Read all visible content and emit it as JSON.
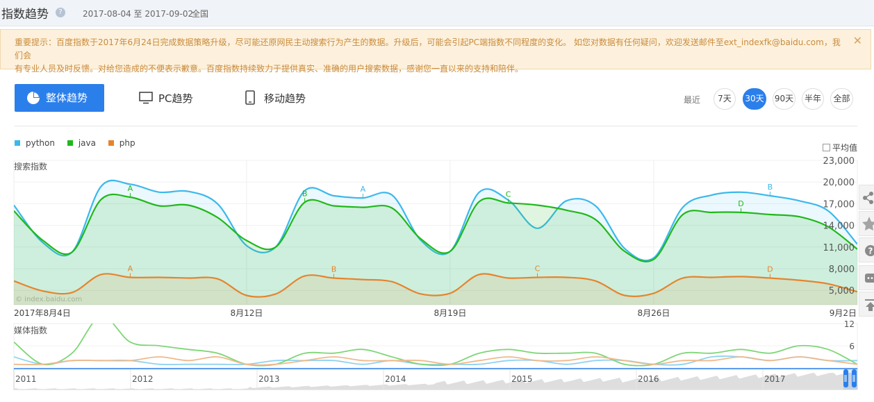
{
  "header": {
    "title": "指数趋势",
    "help_glyph": "?",
    "date_range": "2017-08-04 至 2017-09-02",
    "region": "全国"
  },
  "notice": {
    "line1": "重要提示：百度指数于2017年6月24日完成数据策略升级，尽可能还原网民主动搜索行为产生的数据。升级后，可能会引起PC端指数不同程度的变化。 如您对数据有任何疑问，欢迎发送邮件至ext_indexfk@baidu.com，我们会",
    "line2": "有专业人员及时反馈。对给您造成的不便表示歉意。百度指数持续致力于提供真实、准确的用户搜索数据，感谢您一直以来的支持和陪伴。",
    "close_glyph": "✕"
  },
  "tabs": {
    "overall": "整体趋势",
    "pc": "PC趋势",
    "mobile": "移动趋势"
  },
  "range": {
    "label": "最近",
    "options": [
      "7天",
      "30天",
      "90天",
      "半年",
      "全部"
    ],
    "selected": "30天"
  },
  "legend": {
    "items": [
      {
        "name": "python",
        "color": "#3bb8ec"
      },
      {
        "name": "java",
        "color": "#20b81a"
      },
      {
        "name": "php",
        "color": "#e5842d"
      }
    ]
  },
  "average_toggle": {
    "label": "平均值",
    "checked": false
  },
  "watermark": "© index.baidu.com",
  "icons": {
    "tab_overall": "pie-chart-icon",
    "tab_pc": "monitor-icon",
    "tab_mobile": "phone-icon",
    "side": [
      "share-icon",
      "star-icon",
      "help-icon",
      "chat-icon",
      "back-to-top-icon"
    ]
  },
  "chart_data": [
    {
      "type": "line",
      "title": "搜索指数",
      "x_ticks": [
        "2017年8月4日",
        "8月12日",
        "8月19日",
        "8月26日",
        "9月2日"
      ],
      "y_ticks": [
        "5,000",
        "8,000",
        "11,000",
        "14,000",
        "17,000",
        "20,000",
        "23,000"
      ],
      "ylim": [
        3000,
        23000
      ],
      "grid": true,
      "legend_position": "top-left",
      "x": [
        "2017-08-04",
        "2017-08-05",
        "2017-08-06",
        "2017-08-07",
        "2017-08-08",
        "2017-08-09",
        "2017-08-10",
        "2017-08-11",
        "2017-08-12",
        "2017-08-13",
        "2017-08-14",
        "2017-08-15",
        "2017-08-16",
        "2017-08-17",
        "2017-08-18",
        "2017-08-19",
        "2017-08-20",
        "2017-08-21",
        "2017-08-22",
        "2017-08-23",
        "2017-08-24",
        "2017-08-25",
        "2017-08-26",
        "2017-08-27",
        "2017-08-28",
        "2017-08-29",
        "2017-08-30",
        "2017-08-31",
        "2017-09-01",
        "2017-09-02"
      ],
      "series": [
        {
          "name": "python",
          "color": "#3bb8ec",
          "values": [
            16800,
            11600,
            10300,
            19400,
            19700,
            18600,
            18700,
            17000,
            11200,
            11000,
            18800,
            18100,
            17800,
            18200,
            11900,
            10400,
            18600,
            17500,
            13600,
            17400,
            16700,
            10800,
            9500,
            16500,
            18200,
            18600,
            18100,
            17400,
            16000,
            11400
          ]
        },
        {
          "name": "java",
          "color": "#20b81a",
          "values": [
            16000,
            11900,
            10300,
            17600,
            17900,
            16700,
            16800,
            15100,
            11900,
            11000,
            17200,
            16700,
            16500,
            16400,
            12100,
            10400,
            17300,
            17100,
            16800,
            16100,
            14800,
            10400,
            9300,
            15500,
            15800,
            15800,
            15500,
            15200,
            13800,
            10700
          ]
        },
        {
          "name": "php",
          "color": "#e5842d",
          "values": [
            6300,
            4900,
            4700,
            7200,
            6800,
            6800,
            6700,
            6600,
            4300,
            4500,
            7000,
            6700,
            6500,
            6200,
            4500,
            4600,
            7200,
            6700,
            6800,
            6800,
            6300,
            4300,
            4600,
            6700,
            6800,
            6900,
            6700,
            6400,
            5900,
            4800
          ]
        }
      ],
      "annotations": [
        {
          "series": "python",
          "label": "A",
          "x": "2017-08-16"
        },
        {
          "series": "python",
          "label": "B",
          "x": "2017-08-30"
        },
        {
          "series": "java",
          "label": "A",
          "x": "2017-08-08"
        },
        {
          "series": "java",
          "label": "B",
          "x": "2017-08-14"
        },
        {
          "series": "java",
          "label": "C",
          "x": "2017-08-21"
        },
        {
          "series": "java",
          "label": "D",
          "x": "2017-08-29"
        },
        {
          "series": "php",
          "label": "A",
          "x": "2017-08-08"
        },
        {
          "series": "php",
          "label": "B",
          "x": "2017-08-15"
        },
        {
          "series": "php",
          "label": "C",
          "x": "2017-08-22"
        },
        {
          "series": "php",
          "label": "D",
          "x": "2017-08-30"
        }
      ]
    },
    {
      "type": "line",
      "title": "媒体指数",
      "y_ticks": [
        "6",
        "12"
      ],
      "ylim": [
        0,
        12
      ],
      "series": [
        {
          "name": "python",
          "color": "#8fd3f0",
          "values": [
            3,
            1,
            2,
            2,
            2,
            1,
            1,
            1,
            1,
            2,
            2,
            2,
            1,
            2,
            1,
            1,
            1,
            2,
            2,
            1,
            2,
            2,
            1,
            1,
            3,
            3,
            2,
            3,
            2,
            2
          ]
        },
        {
          "name": "java",
          "color": "#7fd677",
          "values": [
            7,
            1,
            4,
            14,
            7,
            6,
            5,
            4,
            1,
            1,
            4,
            4,
            5,
            3,
            1,
            1,
            4,
            5,
            4,
            4,
            4,
            1,
            1,
            4,
            4,
            5,
            4,
            6,
            5,
            1
          ]
        },
        {
          "name": "php",
          "color": "#f0b98a",
          "values": [
            1,
            1,
            2,
            2,
            2,
            3,
            2,
            3,
            1,
            1,
            2,
            3,
            2,
            2,
            2,
            1,
            2,
            3,
            2,
            2,
            3,
            2,
            1,
            2,
            2,
            3,
            2,
            3,
            2,
            1
          ]
        }
      ]
    },
    {
      "type": "area",
      "title": "",
      "x_ticks": [
        "2011",
        "2012",
        "2013",
        "2014",
        "2015",
        "2016",
        "2017"
      ],
      "color": "#dedede"
    }
  ]
}
